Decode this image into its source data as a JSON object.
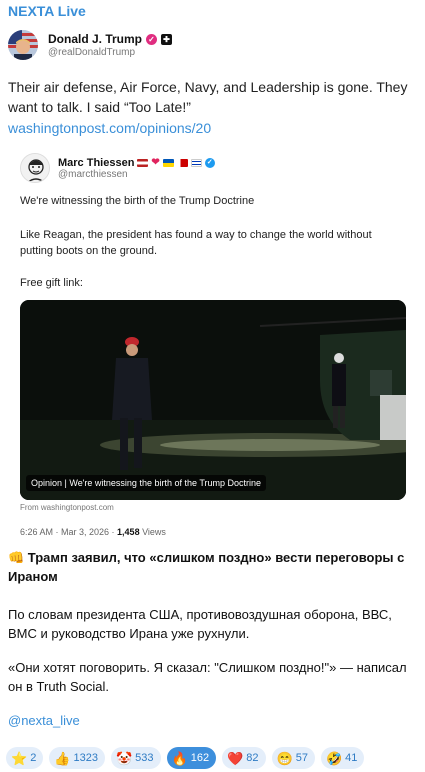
{
  "channel": {
    "title": "NEXTA Live"
  },
  "post": {
    "author_name": "Donald J. Trump",
    "author_handle": "@realDonaldTrump",
    "text": "Their air defense, Air Force, Navy, and Leadership is gone. They want to talk. I said “Too Late!”",
    "link": "washingtonpost.com/opinions/20"
  },
  "quote": {
    "author_name": "Marc Thiessen",
    "author_handle": "@marcthiessen",
    "line1": "We're witnessing the birth of the Trump Doctrine",
    "line2": "Like Reagan, the president has found a way to change the world without putting boots on the ground.",
    "line3": "Free gift link:",
    "media_caption": "Opinion | We're witnessing the birth of the Trump Doctrine",
    "source": "From washingtonpost.com",
    "timestamp": "6:26 AM · Mar 3, 2026 · ",
    "views_count": "1,458",
    "views_label": " Views"
  },
  "message": {
    "title": "👊 Трамп заявил, что «слишком поздно» вести переговоры с Ираном",
    "p1": "По словам президента США, противовоздушная оборона, ВВС, ВМС и руководство Ирана уже рухнули.",
    "p2": "«Они хотят поговорить. Я сказал: \"Слишком поздно!\"» — написал он в Truth Social.",
    "tag": "@nexta_live"
  },
  "reactions": [
    {
      "emoji": "⭐",
      "count": "2"
    },
    {
      "emoji": "👍",
      "count": "1323"
    },
    {
      "emoji": "🤡",
      "count": "533"
    },
    {
      "emoji": "🔥",
      "count": "162"
    },
    {
      "emoji": "❤️",
      "count": "82"
    },
    {
      "emoji": "😁",
      "count": "57"
    },
    {
      "emoji": "🤣",
      "count": "41"
    }
  ],
  "colors": {
    "link": "#3a8fd8",
    "reaction_bg": "#e4eefa",
    "reaction_active": "#3d8fdc"
  }
}
